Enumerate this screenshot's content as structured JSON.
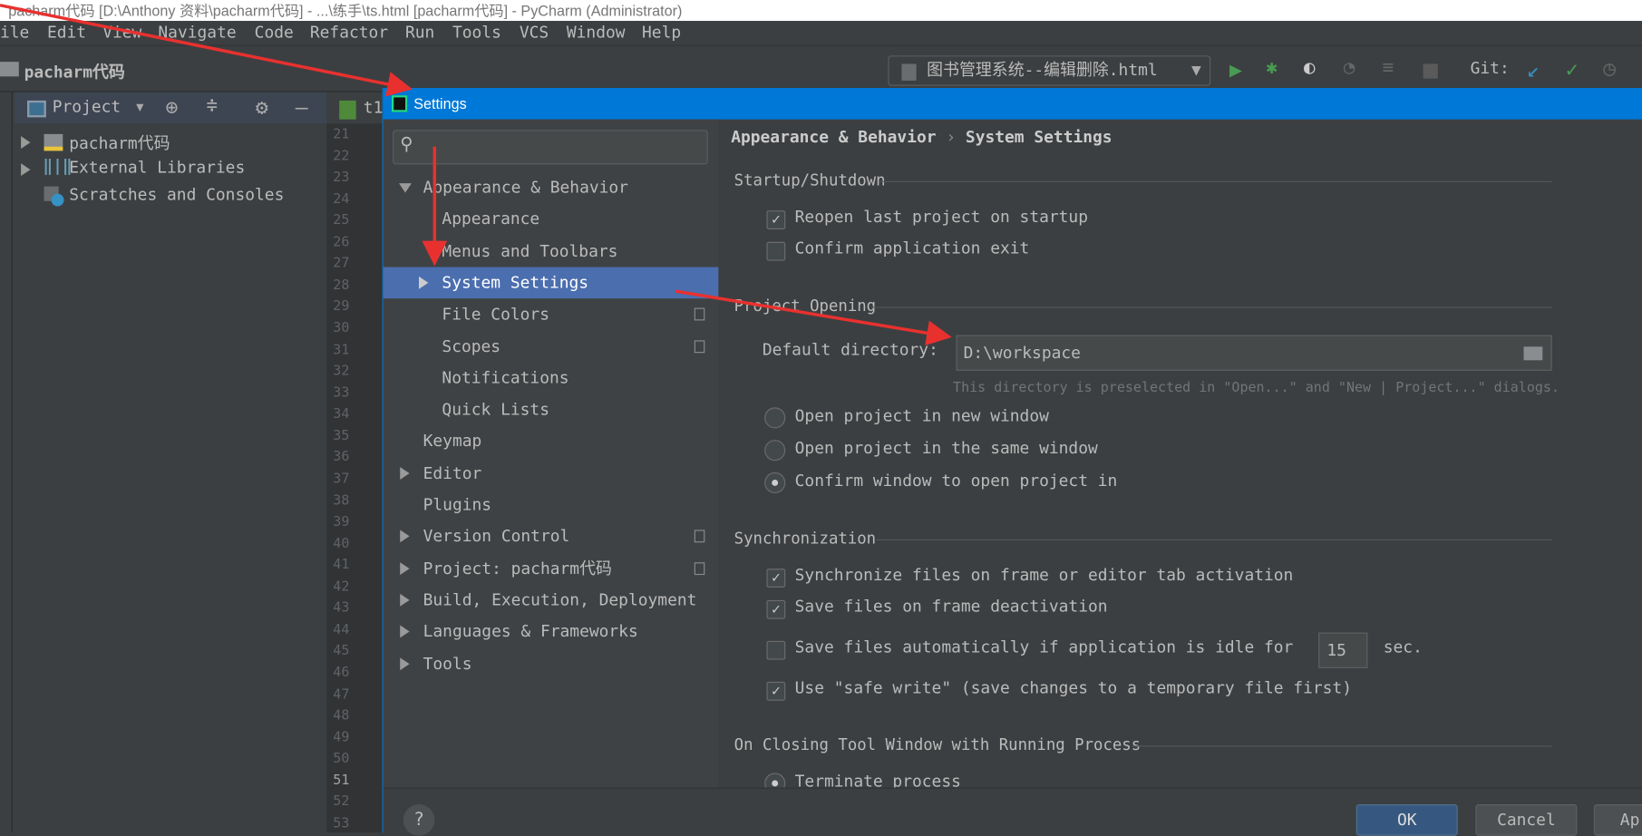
{
  "window": {
    "title": "pacharm代码 [D:\\Anthony 资料\\pacharm代码] - ...\\练手\\ts.html [pacharm代码] - PyCharm (Administrator)"
  },
  "menu": [
    "ile",
    "Edit",
    "View",
    "Navigate",
    "Code",
    "Refactor",
    "Run",
    "Tools",
    "VCS",
    "Window",
    "Help"
  ],
  "toolbar": {
    "project_name": "pacharm代码",
    "run_config": "图书管理系统--编辑删除.html",
    "git_label": "Git:"
  },
  "project_panel": {
    "title": "Project",
    "items": [
      "pacharm代码",
      "External Libraries",
      "Scratches and Consoles"
    ]
  },
  "editor": {
    "tab": "t1",
    "line_numbers": [
      "21",
      "22",
      "23",
      "24",
      "25",
      "26",
      "27",
      "28",
      "29",
      "30",
      "31",
      "32",
      "33",
      "34",
      "35",
      "36",
      "37",
      "38",
      "39",
      "40",
      "41",
      "42",
      "43",
      "44",
      "45",
      "46",
      "47",
      "48",
      "49",
      "50",
      "51",
      "52",
      "53"
    ],
    "current_line": "51"
  },
  "settings": {
    "title": "Settings",
    "search_placeholder": "",
    "tree": [
      {
        "label": "Appearance & Behavior",
        "level": 0,
        "arrow": "down"
      },
      {
        "label": "Appearance",
        "level": 1
      },
      {
        "label": "Menus and Toolbars",
        "level": 1
      },
      {
        "label": "System Settings",
        "level": 1,
        "arrow": "right",
        "selected": true
      },
      {
        "label": "File Colors",
        "level": 1,
        "copy": true
      },
      {
        "label": "Scopes",
        "level": 1,
        "copy": true
      },
      {
        "label": "Notifications",
        "level": 1
      },
      {
        "label": "Quick Lists",
        "level": 1
      },
      {
        "label": "Keymap",
        "level": 0
      },
      {
        "label": "Editor",
        "level": 0,
        "arrow": "right"
      },
      {
        "label": "Plugins",
        "level": 0
      },
      {
        "label": "Version Control",
        "level": 0,
        "arrow": "right",
        "copy": true
      },
      {
        "label": "Project: pacharm代码",
        "level": 0,
        "arrow": "right",
        "copy": true
      },
      {
        "label": "Build, Execution, Deployment",
        "level": 0,
        "arrow": "right"
      },
      {
        "label": "Languages & Frameworks",
        "level": 0,
        "arrow": "right"
      },
      {
        "label": "Tools",
        "level": 0,
        "arrow": "right"
      }
    ],
    "breadcrumb": {
      "parent": "Appearance & Behavior",
      "separator": "›",
      "current": "System Settings"
    },
    "startup": {
      "title": "Startup/Shutdown",
      "reopen": {
        "label": "Reopen last project on startup",
        "checked": true
      },
      "confirm_exit": {
        "label": "Confirm application exit",
        "checked": false
      }
    },
    "project_opening": {
      "title": "Project Opening",
      "dir_label": "Default directory:",
      "dir_value": "D:\\workspace",
      "hint": "This directory is preselected in \"Open...\" and \"New | Project...\" dialogs.",
      "options": [
        {
          "label": "Open project in new window",
          "selected": false
        },
        {
          "label": "Open project in the same window",
          "selected": false
        },
        {
          "label": "Confirm window to open project in",
          "selected": true
        }
      ]
    },
    "sync": {
      "title": "Synchronization",
      "sync_files": {
        "label": "Synchronize files on frame or editor tab activation",
        "checked": true
      },
      "save_deact": {
        "label": "Save files on frame deactivation",
        "checked": true
      },
      "save_auto": {
        "label": "Save files automatically if application is idle for",
        "checked": false,
        "value": "15",
        "unit": "sec."
      },
      "safe_write": {
        "label": "Use \"safe write\" (save changes to a temporary file first)",
        "checked": true
      }
    },
    "closing": {
      "title": "On Closing Tool Window with Running Process",
      "terminate": {
        "label": "Terminate process",
        "selected": true
      }
    },
    "buttons": {
      "ok": "OK",
      "cancel": "Cancel",
      "apply": "Ap",
      "help": "?"
    }
  },
  "colors": {
    "dialog_title": "#0078d7",
    "selection": "#4b6eaf",
    "ok_button": "#365880",
    "annotation_arrow": "#e8312f"
  }
}
